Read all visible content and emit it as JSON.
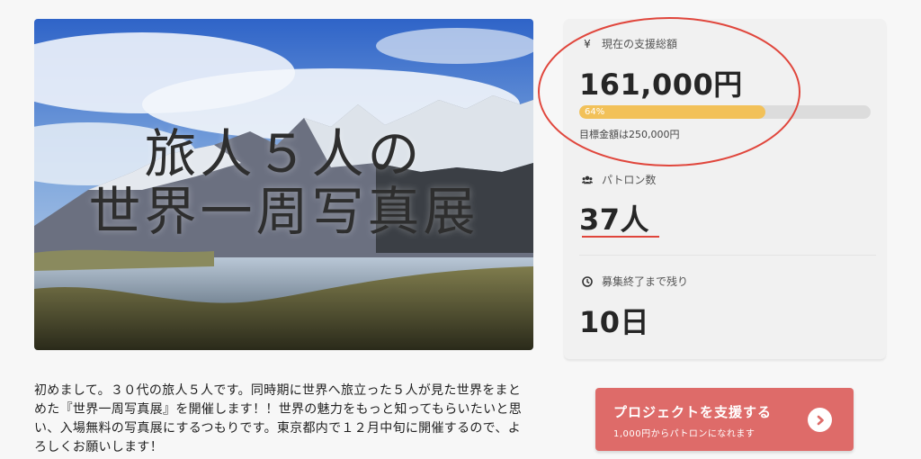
{
  "hero": {
    "title_line1": "旅人５人の",
    "title_line2": "世界一周写真展"
  },
  "description": "初めまして。３０代の旅人５人です。同時期に世界へ旅立った５人が見た世界をまとめた『世界一周写真展』を開催します！！世界の魅力をもっと知ってもらいたいと思い、入場無料の写真展にするつもりです。東京都内で１２月中旬に開催するので、よろしくお願いします！",
  "stats": {
    "funding": {
      "icon": "yen-icon",
      "icon_glyph": "¥",
      "label": "現在の支援総額",
      "amount": "161,000円",
      "progress_percent": 64,
      "progress_label": "64%",
      "goal": "目標金額は250,000円"
    },
    "patrons": {
      "icon": "users-icon",
      "label": "パトロン数",
      "count": "37人"
    },
    "remaining": {
      "icon": "clock-icon",
      "label": "募集終了まで残り",
      "value": "10日"
    }
  },
  "cta": {
    "label": "プロジェクトを支援する",
    "sublabel": "1,000円からパトロンになれます",
    "icon": "chevron-right-icon"
  },
  "colors": {
    "progress_fill": "#f2c159",
    "cta_background": "#de6b69",
    "annotation": "#e0463c"
  }
}
